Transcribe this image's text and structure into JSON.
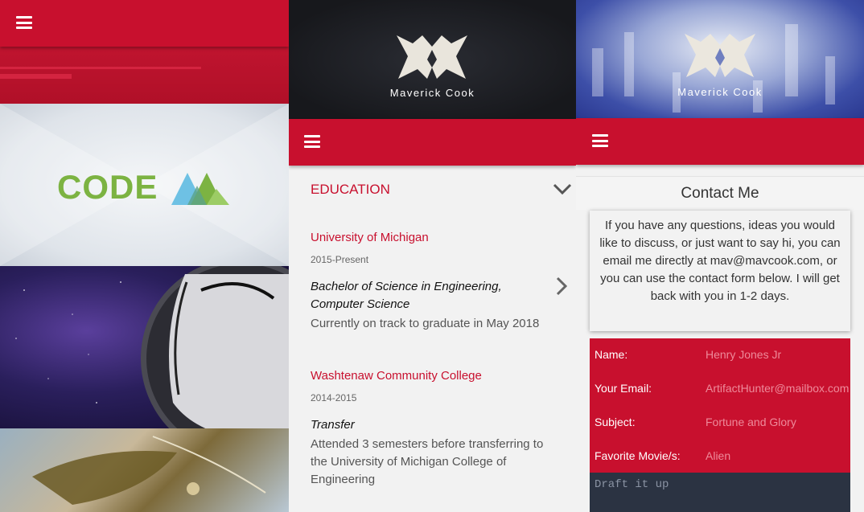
{
  "portfolio": {
    "code_word": "CODE"
  },
  "resume": {
    "name": "Maverick Cook",
    "section_title": "EDUCATION",
    "education": [
      {
        "school": "University of Michigan",
        "years": "2015-Present",
        "degree_line1": "Bachelor of Science in Engineering,",
        "degree_line2": "Computer Science",
        "description": "Currently on track to graduate in May 2018"
      },
      {
        "school": "Washtenaw Community College",
        "years": "2014-2015",
        "degree": "Transfer",
        "description": "Attended 3 semesters before transferring to the University of Michigan College of Engineering"
      }
    ]
  },
  "contact": {
    "name": "Maverick Cook",
    "title": "Contact Me",
    "message": "If you have any questions, ideas you would like to discuss, or just want to say hi, you can email me directly at mav@mavcook.com, or you can use the contact form below. I will get back with you in 1-2 days.",
    "form": {
      "name_label": "Name:",
      "name_placeholder": "Henry Jones Jr",
      "email_label": "Your Email:",
      "email_placeholder": "ArtifactHunter@mailbox.com",
      "subject_label": "Subject:",
      "subject_placeholder": "Fortune and Glory",
      "movie_label": "Favorite Movie/s:",
      "movie_placeholder": "Alien",
      "message_placeholder": "Draft it up"
    }
  },
  "colors": {
    "accent": "#c8102e",
    "code_green": "#7cb342",
    "mountain_blue": "#6ec1e4"
  },
  "icons": [
    "menu-icon",
    "chevron-down-icon",
    "chevron-right-icon",
    "mc-logo-icon"
  ]
}
